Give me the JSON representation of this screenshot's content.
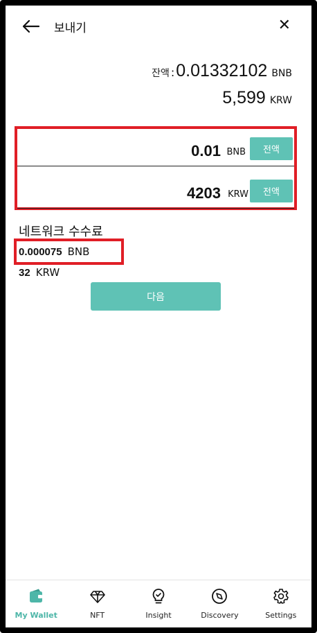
{
  "header": {
    "title": "보내기",
    "back_icon": "arrow-left-icon",
    "close_icon": "close-icon",
    "close_glyph": "✕"
  },
  "balance": {
    "label": "잔액",
    "colon": ":",
    "amount": "0.01332102",
    "unit": "BNB",
    "fiat_amount": "5,599",
    "fiat_unit": "KRW"
  },
  "send": {
    "coin_amount": "0.01",
    "coin_unit": "BNB",
    "coin_max_label": "전액",
    "fiat_amount": "4203",
    "fiat_unit": "KRW",
    "fiat_max_label": "전액"
  },
  "fee": {
    "title": "네트워크 수수료",
    "coin_amount": "0.000075",
    "coin_unit": "BNB",
    "fiat_amount": "32",
    "fiat_unit": "KRW"
  },
  "next_button": "다음",
  "colors": {
    "accent": "#5fc2b5",
    "highlight_border": "#e01e26",
    "active_tab": "#4db6a8"
  },
  "tabs": [
    {
      "label": "My Wallet",
      "icon": "wallet-icon",
      "active": true
    },
    {
      "label": "NFT",
      "icon": "diamond-icon",
      "active": false
    },
    {
      "label": "Insight",
      "icon": "lightbulb-icon",
      "active": false
    },
    {
      "label": "Discovery",
      "icon": "compass-icon",
      "active": false
    },
    {
      "label": "Settings",
      "icon": "gear-icon",
      "active": false
    }
  ]
}
